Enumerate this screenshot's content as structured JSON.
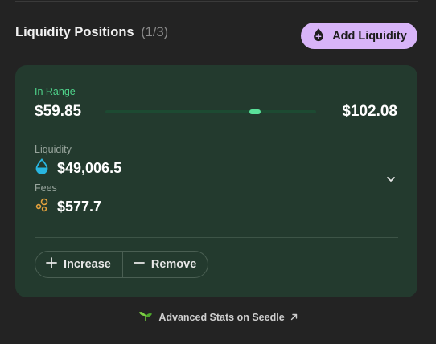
{
  "header": {
    "title": "Liquidity Positions",
    "count": "(1/3)",
    "add_button_label": "Add Liquidity",
    "add_button_icon": "drop-plus-icon"
  },
  "position": {
    "status": "In Range",
    "min_price": "$59.85",
    "max_price": "$102.08",
    "current_price_fraction": 0.72,
    "liquidity_label": "Liquidity",
    "liquidity_value": "$49,006.5",
    "liquidity_icon": "drop-icon",
    "fees_label": "Fees",
    "fees_value": "$577.7",
    "fees_icon": "coins-icon",
    "expand_icon": "chevron-down-icon",
    "increase_label": "Increase",
    "remove_label": "Remove"
  },
  "footer": {
    "link_label": "Advanced Stats on Seedle",
    "link_icon": "arrow-up-right-icon",
    "brand_icon": "sprout-icon"
  },
  "colors": {
    "background": "#232323",
    "card": "#233a2e",
    "accent_purple": "#d8b4f8",
    "in_range_green": "#4fd48b",
    "liquidity_blue": "#29b6e0",
    "fees_orange": "#e6a23c"
  }
}
